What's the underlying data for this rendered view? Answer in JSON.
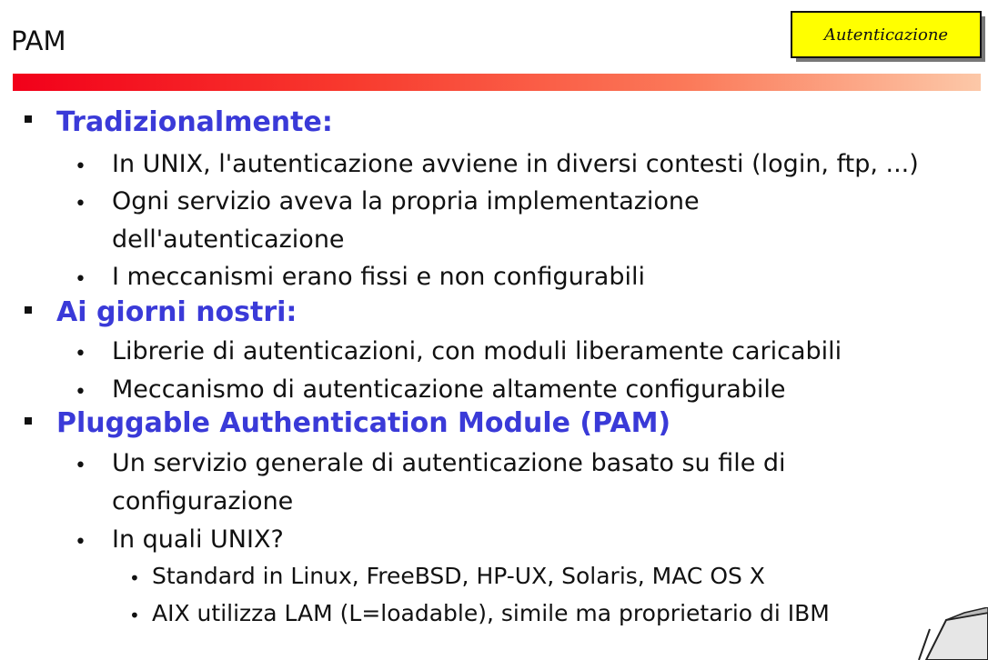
{
  "slide": {
    "title": "PAM",
    "tag": "Autenticazione"
  },
  "sections": [
    {
      "heading": "Tradizionalmente:",
      "bullets": [
        "In UNIX, l'autenticazione avviene in diversi contesti (login, ftp, ...)",
        "Ogni servizio aveva la propria implementazione",
        "dell'autenticazione",
        "I meccanismi erano fissi e non configurabili"
      ]
    },
    {
      "heading": "Ai giorni nostri:",
      "bullets": [
        "Librerie di autenticazioni, con moduli liberamente caricabili",
        "Meccanismo di autenticazione altamente configurabile"
      ]
    },
    {
      "heading": "Pluggable Authentication Module (PAM)",
      "bullets": [
        "Un servizio generale di autenticazione basato su file di",
        "configurazione",
        "In quali UNIX?"
      ],
      "subbullets": [
        "Standard in Linux, FreeBSD, HP-UX, Solaris, MAC OS X",
        "AIX utilizza LAM (L=loadable), simile ma proprietario di IBM"
      ]
    }
  ]
}
